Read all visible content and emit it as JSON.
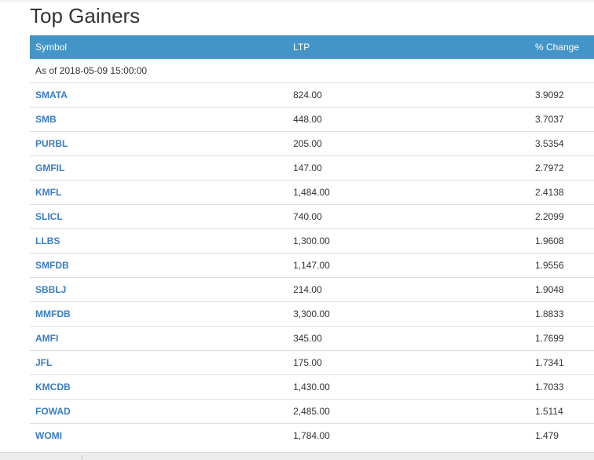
{
  "page": {
    "title": "Top Gainers"
  },
  "table": {
    "headers": {
      "symbol": "Symbol",
      "ltp": "LTP",
      "change": "% Change"
    },
    "as_of": "As of 2018-05-09 15:00:00",
    "rows": [
      {
        "symbol": "SMATA",
        "ltp": "824.00",
        "change": "3.9092"
      },
      {
        "symbol": "SMB",
        "ltp": "448.00",
        "change": "3.7037"
      },
      {
        "symbol": "PURBL",
        "ltp": "205.00",
        "change": "3.5354"
      },
      {
        "symbol": "GMFIL",
        "ltp": "147.00",
        "change": "2.7972"
      },
      {
        "symbol": "KMFL",
        "ltp": "1,484.00",
        "change": "2.4138"
      },
      {
        "symbol": "SLICL",
        "ltp": "740.00",
        "change": "2.2099"
      },
      {
        "symbol": "LLBS",
        "ltp": "1,300.00",
        "change": "1.9608"
      },
      {
        "symbol": "SMFDB",
        "ltp": "1,147.00",
        "change": "1.9556"
      },
      {
        "symbol": "SBBLJ",
        "ltp": "214.00",
        "change": "1.9048"
      },
      {
        "symbol": "MMFDB",
        "ltp": "3,300.00",
        "change": "1.8833"
      },
      {
        "symbol": "AMFI",
        "ltp": "345.00",
        "change": "1.7699"
      },
      {
        "symbol": "JFL",
        "ltp": "175.00",
        "change": "1.7341"
      },
      {
        "symbol": "KMCDB",
        "ltp": "1,430.00",
        "change": "1.7033"
      },
      {
        "symbol": "FOWAD",
        "ltp": "2,485.00",
        "change": "1.5114"
      },
      {
        "symbol": "WOMI",
        "ltp": "1,784.00",
        "change": "1.479"
      }
    ]
  },
  "colors": {
    "header_bg": "#4394c7",
    "link": "#3a7cc1",
    "text": "#333333",
    "row_border": "#dddddd"
  }
}
